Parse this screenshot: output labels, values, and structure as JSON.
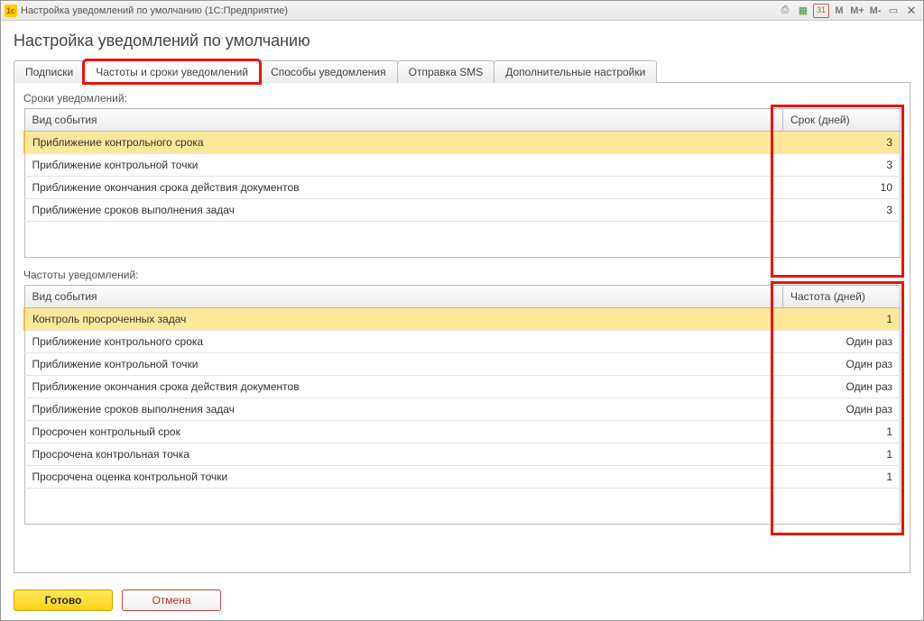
{
  "window": {
    "app_icon_text": "1c",
    "title": "Настройка уведомлений по умолчанию  (1С:Предприятие)"
  },
  "titlebar_controls": {
    "print": "⎙",
    "calc": "▦",
    "calendar": "31",
    "m": "M",
    "mplus": "M+",
    "mminus": "M-",
    "minimize": "▭",
    "close": "✕"
  },
  "page": {
    "title": "Настройка уведомлений по умолчанию"
  },
  "tabs": [
    {
      "label": "Подписки"
    },
    {
      "label": "Частоты и сроки уведомлений",
      "active": true,
      "highlight": true
    },
    {
      "label": "Способы уведомления"
    },
    {
      "label": "Отправка SMS"
    },
    {
      "label": "Дополнительные настройки"
    }
  ],
  "section_terms": {
    "label": "Сроки уведомлений:",
    "col_event": "Вид события",
    "col_value": "Срок (дней)",
    "rows": [
      {
        "event": "Приближение контрольного срока",
        "value": "3",
        "selected": true
      },
      {
        "event": "Приближение контрольной точки",
        "value": "3"
      },
      {
        "event": "Приближение окончания срока действия документов",
        "value": "10"
      },
      {
        "event": "Приближение сроков выполнения задач",
        "value": "3"
      }
    ]
  },
  "section_freq": {
    "label": "Частоты уведомлений:",
    "col_event": "Вид события",
    "col_value": "Частота (дней)",
    "rows": [
      {
        "event": "Контроль просроченных задач",
        "value": "1",
        "selected": true
      },
      {
        "event": "Приближение контрольного срока",
        "value": "Один раз"
      },
      {
        "event": "Приближение контрольной точки",
        "value": "Один раз"
      },
      {
        "event": "Приближение окончания срока действия документов",
        "value": "Один раз"
      },
      {
        "event": "Приближение сроков выполнения задач",
        "value": "Один раз"
      },
      {
        "event": "Просрочен контрольный срок",
        "value": "1"
      },
      {
        "event": "Просрочена контрольная точка",
        "value": "1"
      },
      {
        "event": "Просрочена оценка контрольной точки",
        "value": "1"
      }
    ]
  },
  "buttons": {
    "ok": "Готово",
    "cancel": "Отмена"
  }
}
